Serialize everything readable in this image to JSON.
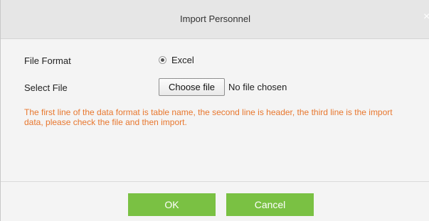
{
  "dialog": {
    "title": "Import Personnel",
    "close_symbol": "×"
  },
  "form": {
    "file_format": {
      "label": "File Format",
      "option": "Excel",
      "selected": true
    },
    "select_file": {
      "label": "Select File",
      "button_label": "Choose file",
      "status": "No file chosen"
    },
    "notice": "The first line of the data format is table name, the second line is header, the third line is the import data, please check the file and then import."
  },
  "footer": {
    "ok_label": "OK",
    "cancel_label": "Cancel"
  },
  "colors": {
    "accent_green": "#7ac143",
    "notice_orange": "#e8772e"
  },
  "icons": {
    "close": "close-icon",
    "radio": "radio-selected-icon"
  }
}
